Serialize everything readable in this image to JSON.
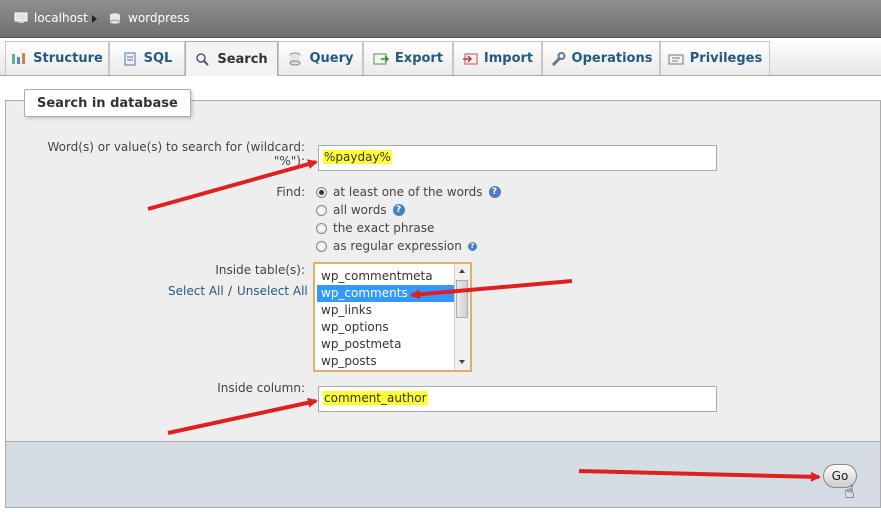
{
  "breadcrumb": {
    "server": "localhost",
    "database": "wordpress"
  },
  "tabs": [
    {
      "label": "Structure",
      "icon": "structure-icon"
    },
    {
      "label": "SQL",
      "icon": "sql-icon"
    },
    {
      "label": "Search",
      "icon": "search-icon",
      "active": true
    },
    {
      "label": "Query",
      "icon": "query-icon"
    },
    {
      "label": "Export",
      "icon": "export-icon"
    },
    {
      "label": "Import",
      "icon": "import-icon"
    },
    {
      "label": "Operations",
      "icon": "wrench-icon"
    },
    {
      "label": "Privileges",
      "icon": "privileges-icon"
    }
  ],
  "form": {
    "legend": "Search in database",
    "words_label": "Word(s) or value(s) to search for (wildcard: \"%\"):",
    "words_value": "%payday%",
    "find_label": "Find:",
    "find_options": [
      {
        "label": "at least one of the words",
        "checked": true
      },
      {
        "label": "all words",
        "checked": false
      },
      {
        "label": "the exact phrase",
        "checked": false
      },
      {
        "label": "as regular expression",
        "checked": false
      }
    ],
    "tables_label": "Inside table(s):",
    "select_all": "Select All",
    "select_separator": "/",
    "unselect_all": "Unselect All",
    "tables": [
      "wp_commentmeta",
      "wp_comments",
      "wp_links",
      "wp_options",
      "wp_postmeta",
      "wp_posts"
    ],
    "selected_table": "wp_comments",
    "column_label": "Inside column:",
    "column_value": "comment_author",
    "go": "Go"
  },
  "colors": {
    "highlight": "#ffff33",
    "arrow": "#e02020",
    "selection": "#3399ff"
  }
}
